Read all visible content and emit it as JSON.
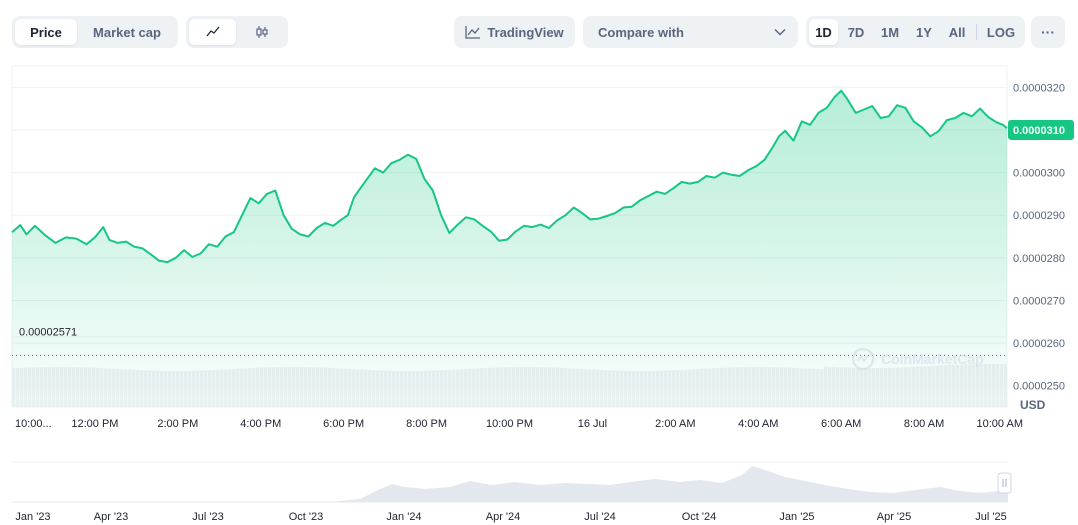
{
  "toolbar": {
    "metric_tabs": [
      {
        "label": "Price",
        "active": true
      },
      {
        "label": "Market cap",
        "active": false
      }
    ],
    "chart_type_icons": [
      "line-chart-icon",
      "candlestick-icon"
    ],
    "tradingview_label": "TradingView",
    "compare_label": "Compare with",
    "ranges": [
      {
        "label": "1D",
        "active": true
      },
      {
        "label": "7D",
        "active": false
      },
      {
        "label": "1M",
        "active": false
      },
      {
        "label": "1Y",
        "active": false
      },
      {
        "label": "All",
        "active": false
      }
    ],
    "log_label": "LOG",
    "more_label": "···"
  },
  "colors": {
    "line": "#16c784",
    "current_badge": "#16c784",
    "grid": "#eff2f5",
    "axis_text": "#58667e",
    "volume": "#eef1f4",
    "navigator": "#e3e8ee"
  },
  "watermark": "CoinMarketCap",
  "chart_data": {
    "type": "area",
    "currency_label": "USD",
    "y_ticks": [
      "0.0000320",
      "0.0000310",
      "0.0000300",
      "0.0000290",
      "0.0000280",
      "0.0000270",
      "0.0000260",
      "0.0000250"
    ],
    "ylim": [
      2.45e-05,
      3.25e-05
    ],
    "current_price": "0.0000310",
    "current_value": 3.1e-05,
    "low_label": "0.00002571",
    "low_value": 2.571e-05,
    "x_ticks": [
      "10:00...",
      "12:00 PM",
      "2:00 PM",
      "4:00 PM",
      "6:00 PM",
      "8:00 PM",
      "10:00 PM",
      "16 Jul",
      "2:00 AM",
      "4:00 AM",
      "6:00 AM",
      "8:00 AM",
      "10:00 AM"
    ],
    "x_tick_hours": [
      0.1,
      2,
      4,
      6,
      8,
      10,
      12,
      14,
      16,
      18,
      20,
      22,
      24
    ],
    "x_range_hours": [
      0,
      24
    ],
    "points": [
      [
        0,
        2.86
      ],
      [
        0.2,
        2.877
      ],
      [
        0.35,
        2.855
      ],
      [
        0.55,
        2.875
      ],
      [
        0.8,
        2.853
      ],
      [
        1.05,
        2.835
      ],
      [
        1.3,
        2.848
      ],
      [
        1.55,
        2.845
      ],
      [
        1.8,
        2.832
      ],
      [
        2.0,
        2.848
      ],
      [
        2.2,
        2.872
      ],
      [
        2.35,
        2.842
      ],
      [
        2.55,
        2.835
      ],
      [
        2.75,
        2.838
      ],
      [
        2.95,
        2.826
      ],
      [
        3.15,
        2.822
      ],
      [
        3.35,
        2.808
      ],
      [
        3.55,
        2.793
      ],
      [
        3.75,
        2.79
      ],
      [
        3.95,
        2.8
      ],
      [
        4.15,
        2.818
      ],
      [
        4.35,
        2.802
      ],
      [
        4.55,
        2.81
      ],
      [
        4.75,
        2.832
      ],
      [
        4.95,
        2.826
      ],
      [
        5.15,
        2.85
      ],
      [
        5.35,
        2.86
      ],
      [
        5.55,
        2.9
      ],
      [
        5.75,
        2.94
      ],
      [
        5.95,
        2.928
      ],
      [
        6.15,
        2.95
      ],
      [
        6.35,
        2.958
      ],
      [
        6.55,
        2.9
      ],
      [
        6.75,
        2.868
      ],
      [
        6.95,
        2.855
      ],
      [
        7.15,
        2.85
      ],
      [
        7.35,
        2.87
      ],
      [
        7.55,
        2.882
      ],
      [
        7.75,
        2.875
      ],
      [
        7.95,
        2.89
      ],
      [
        8.1,
        2.9
      ],
      [
        8.25,
        2.942
      ],
      [
        8.4,
        2.963
      ],
      [
        8.55,
        2.983
      ],
      [
        8.75,
        3.01
      ],
      [
        8.95,
        3.0
      ],
      [
        9.15,
        3.022
      ],
      [
        9.35,
        3.03
      ],
      [
        9.55,
        3.042
      ],
      [
        9.75,
        3.032
      ],
      [
        9.95,
        2.985
      ],
      [
        10.15,
        2.958
      ],
      [
        10.35,
        2.9
      ],
      [
        10.55,
        2.858
      ],
      [
        10.75,
        2.878
      ],
      [
        10.95,
        2.895
      ],
      [
        11.15,
        2.89
      ],
      [
        11.35,
        2.875
      ],
      [
        11.55,
        2.862
      ],
      [
        11.75,
        2.84
      ],
      [
        11.95,
        2.843
      ],
      [
        12.15,
        2.862
      ],
      [
        12.35,
        2.875
      ],
      [
        12.55,
        2.872
      ],
      [
        12.75,
        2.878
      ],
      [
        12.95,
        2.87
      ],
      [
        13.15,
        2.888
      ],
      [
        13.35,
        2.9
      ],
      [
        13.55,
        2.918
      ],
      [
        13.75,
        2.905
      ],
      [
        13.95,
        2.89
      ],
      [
        14.15,
        2.892
      ],
      [
        14.35,
        2.898
      ],
      [
        14.55,
        2.905
      ],
      [
        14.75,
        2.918
      ],
      [
        14.95,
        2.92
      ],
      [
        15.15,
        2.935
      ],
      [
        15.35,
        2.945
      ],
      [
        15.55,
        2.955
      ],
      [
        15.75,
        2.95
      ],
      [
        15.95,
        2.963
      ],
      [
        16.15,
        2.978
      ],
      [
        16.35,
        2.974
      ],
      [
        16.55,
        2.978
      ],
      [
        16.75,
        2.992
      ],
      [
        16.95,
        2.988
      ],
      [
        17.15,
        3.0
      ],
      [
        17.35,
        2.995
      ],
      [
        17.55,
        2.992
      ],
      [
        17.75,
        3.005
      ],
      [
        17.95,
        3.015
      ],
      [
        18.15,
        3.03
      ],
      [
        18.35,
        3.06
      ],
      [
        18.5,
        3.085
      ],
      [
        18.65,
        3.098
      ],
      [
        18.85,
        3.075
      ],
      [
        19.05,
        3.12
      ],
      [
        19.25,
        3.112
      ],
      [
        19.45,
        3.14
      ],
      [
        19.65,
        3.152
      ],
      [
        19.85,
        3.178
      ],
      [
        20.0,
        3.192
      ],
      [
        20.15,
        3.172
      ],
      [
        20.35,
        3.14
      ],
      [
        20.55,
        3.148
      ],
      [
        20.75,
        3.156
      ],
      [
        20.95,
        3.128
      ],
      [
        21.15,
        3.132
      ],
      [
        21.35,
        3.158
      ],
      [
        21.55,
        3.152
      ],
      [
        21.75,
        3.12
      ],
      [
        21.95,
        3.106
      ],
      [
        22.15,
        3.085
      ],
      [
        22.35,
        3.097
      ],
      [
        22.55,
        3.123
      ],
      [
        22.75,
        3.128
      ],
      [
        22.95,
        3.14
      ],
      [
        23.15,
        3.132
      ],
      [
        23.35,
        3.15
      ],
      [
        23.55,
        3.13
      ],
      [
        23.75,
        3.118
      ],
      [
        23.9,
        3.112
      ],
      [
        24,
        3.104
      ]
    ],
    "navigator": {
      "x_ticks": [
        "Jan '23",
        "Apr '23",
        "Jul '23",
        "Oct '23",
        "Jan '24",
        "Apr '24",
        "Jul '24",
        "Oct '24",
        "Jan '25",
        "Apr '25",
        "Jul '25"
      ]
    }
  }
}
